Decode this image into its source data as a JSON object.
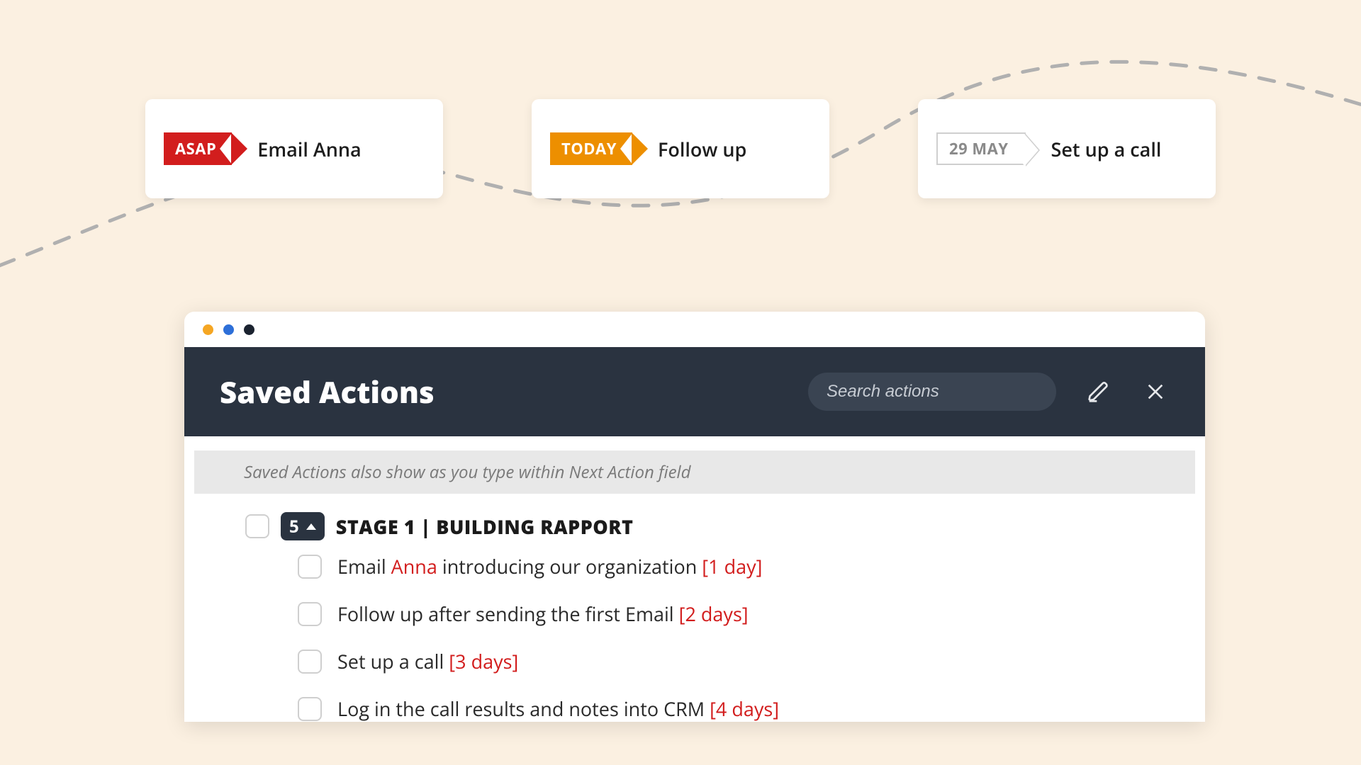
{
  "timeline": [
    {
      "tag_label": "ASAP",
      "tag_style": "red",
      "task": "Email Anna"
    },
    {
      "tag_label": "TODAY",
      "tag_style": "orange",
      "task": "Follow up"
    },
    {
      "tag_label": "29 MAY",
      "tag_style": "outline",
      "task": "Set up a call"
    }
  ],
  "window": {
    "header": {
      "title": "Saved Actions",
      "search_placeholder": "Search actions"
    },
    "hint": "Saved Actions also show as you type within Next Action field",
    "stage": {
      "count": "5",
      "title": "STAGE 1 | BUILDING RAPPORT"
    },
    "actions": [
      {
        "pre": "Email ",
        "highlight": "Anna",
        "post": " introducing our organization ",
        "duration": "[1 day]"
      },
      {
        "pre": "Follow up after sending the first Email ",
        "highlight": "",
        "post": "",
        "duration": "[2 days]"
      },
      {
        "pre": "Set up a call ",
        "highlight": "",
        "post": "",
        "duration": "[3 days]"
      },
      {
        "pre": "Log in the call results and notes into CRM ",
        "highlight": "",
        "post": "",
        "duration": "[4 days]"
      }
    ]
  }
}
